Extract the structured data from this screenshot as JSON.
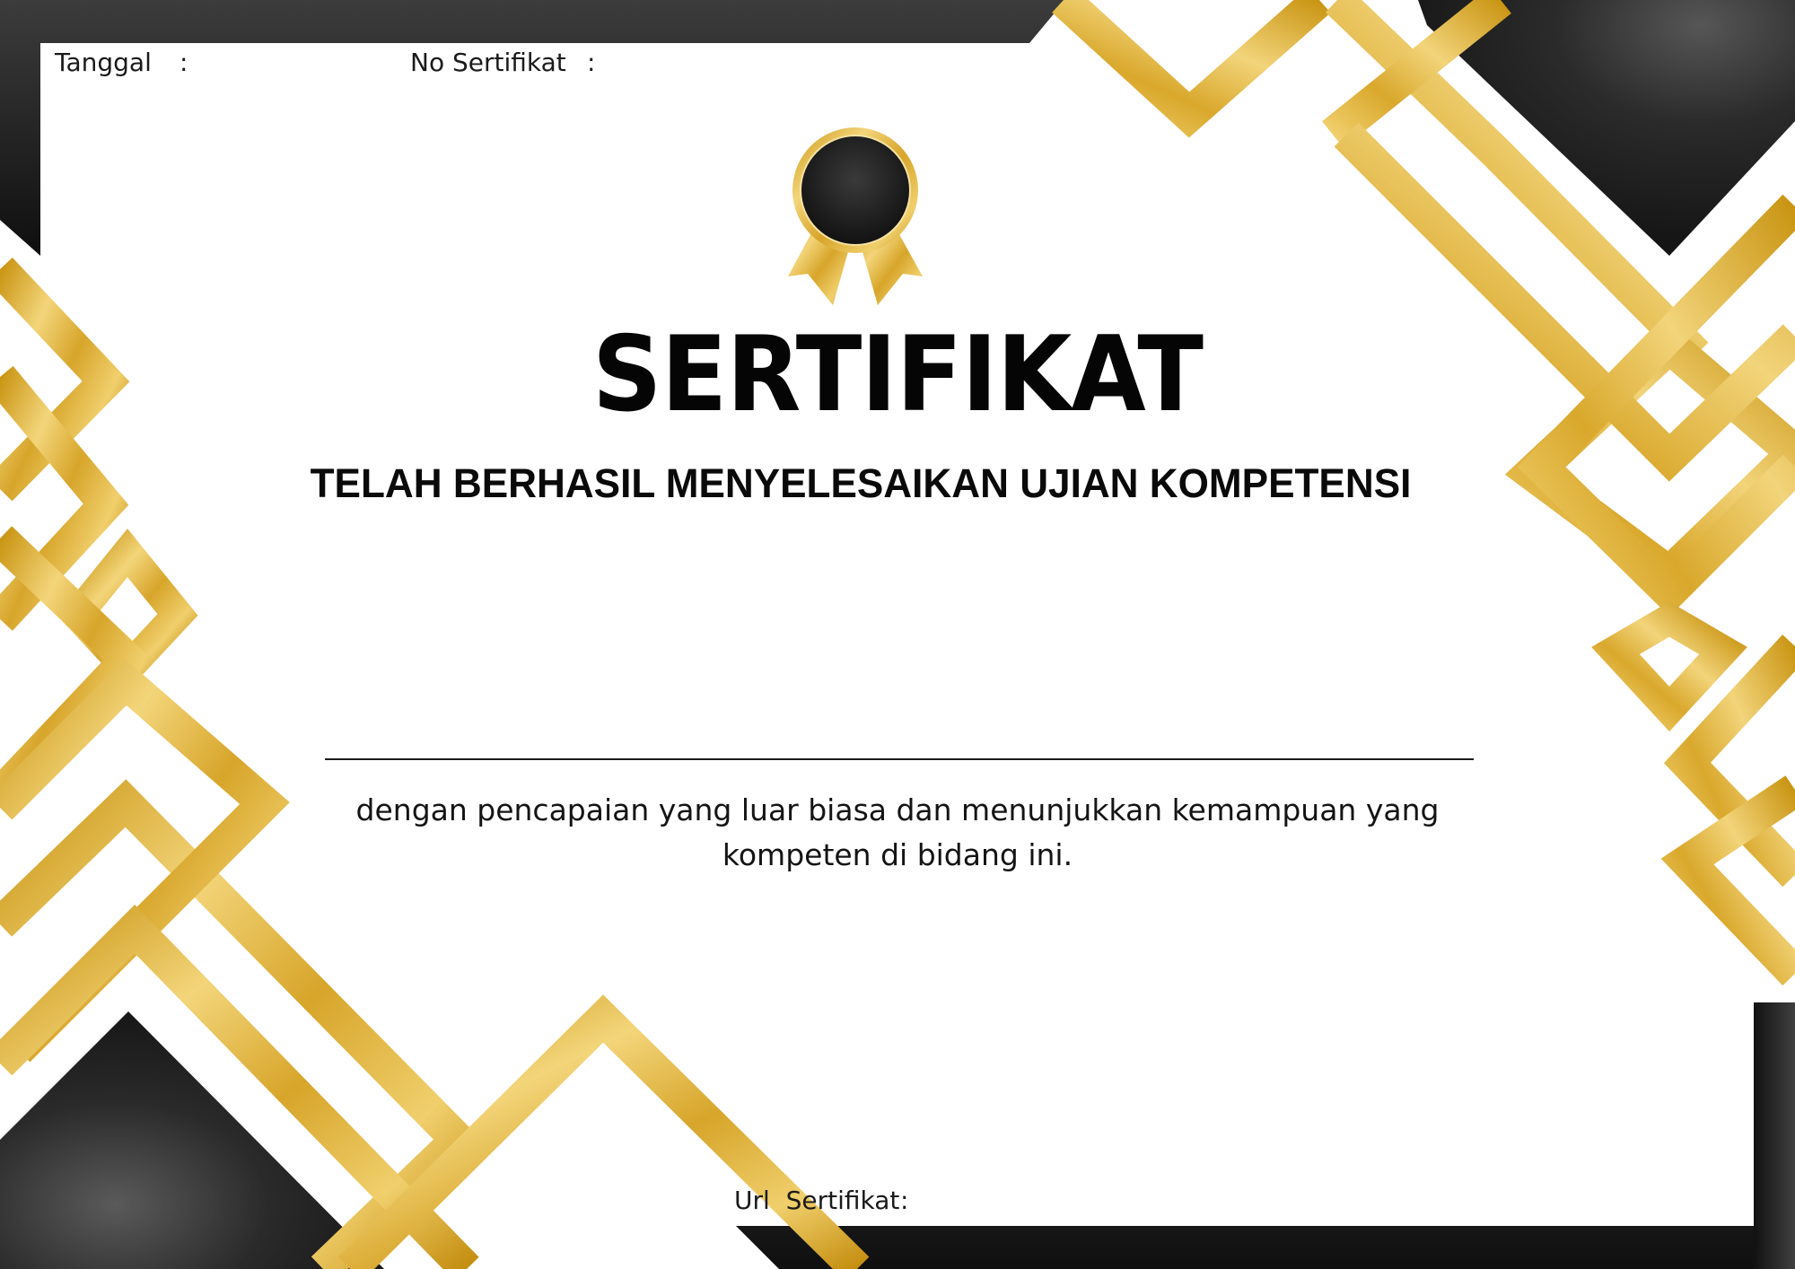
{
  "header": {
    "date_label": "Tanggal",
    "date_colon": ":",
    "certificate_number_label": "No Sertifikat",
    "certificate_number_colon": ":"
  },
  "title": "SERTIFIKAT",
  "subtitle": "TELAH BERHASIL MENYELESAIKAN UJIAN KOMPETENSI",
  "description": "dengan pencapaian yang luar biasa dan menunjukkan kemampuan yang kompeten di bidang ini.",
  "footer": {
    "url_label": "Url  Sertifikat",
    "url_colon": ":"
  },
  "colors": {
    "gold": "#d6a72a",
    "gold_light": "#f3d57a",
    "black": "#1c1c1c",
    "dark_gray": "#4a4a4a",
    "text": "#111111",
    "background": "#ffffff"
  },
  "icons": {
    "badge": "award-ribbon-icon"
  }
}
